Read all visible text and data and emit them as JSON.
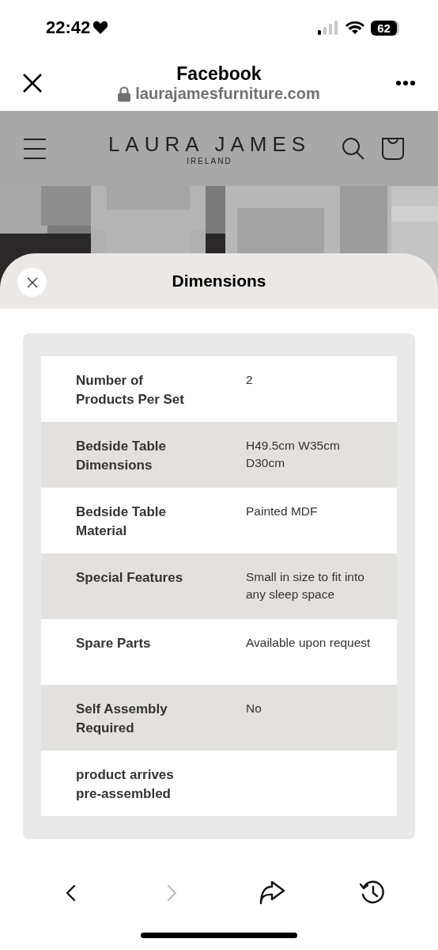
{
  "status_bar": {
    "time": "22:42",
    "battery": "62"
  },
  "browser": {
    "title": "Facebook",
    "url": "laurajamesfurniture.com"
  },
  "site_header": {
    "logo": "LAURA JAMES",
    "logo_subtitle": "IRELAND"
  },
  "sheet": {
    "title": "Dimensions",
    "rows": [
      {
        "label": "Number of Products Per Set",
        "value": "2",
        "shaded": false
      },
      {
        "label": "Bedside Table Dimensions",
        "value": "H49.5cm W35cm D30cm",
        "shaded": true
      },
      {
        "label": "Bedside Table Material",
        "value": "Painted MDF",
        "shaded": false
      },
      {
        "label": "Special Features",
        "value": "Small in size to fit into any sleep space",
        "shaded": true
      },
      {
        "label": "Spare Parts",
        "value": "Available upon request",
        "shaded": false
      },
      {
        "label": "Self Assembly Required",
        "value": "No",
        "shaded": true
      },
      {
        "label": "product arrives pre-assembled",
        "shaded": false
      }
    ]
  },
  "toolbar": [
    {
      "kind": "back",
      "disabled": false
    },
    {
      "kind": "forward",
      "disabled": true
    },
    {
      "kind": "share",
      "disabled": false
    },
    {
      "kind": "history",
      "disabled": false
    }
  ]
}
